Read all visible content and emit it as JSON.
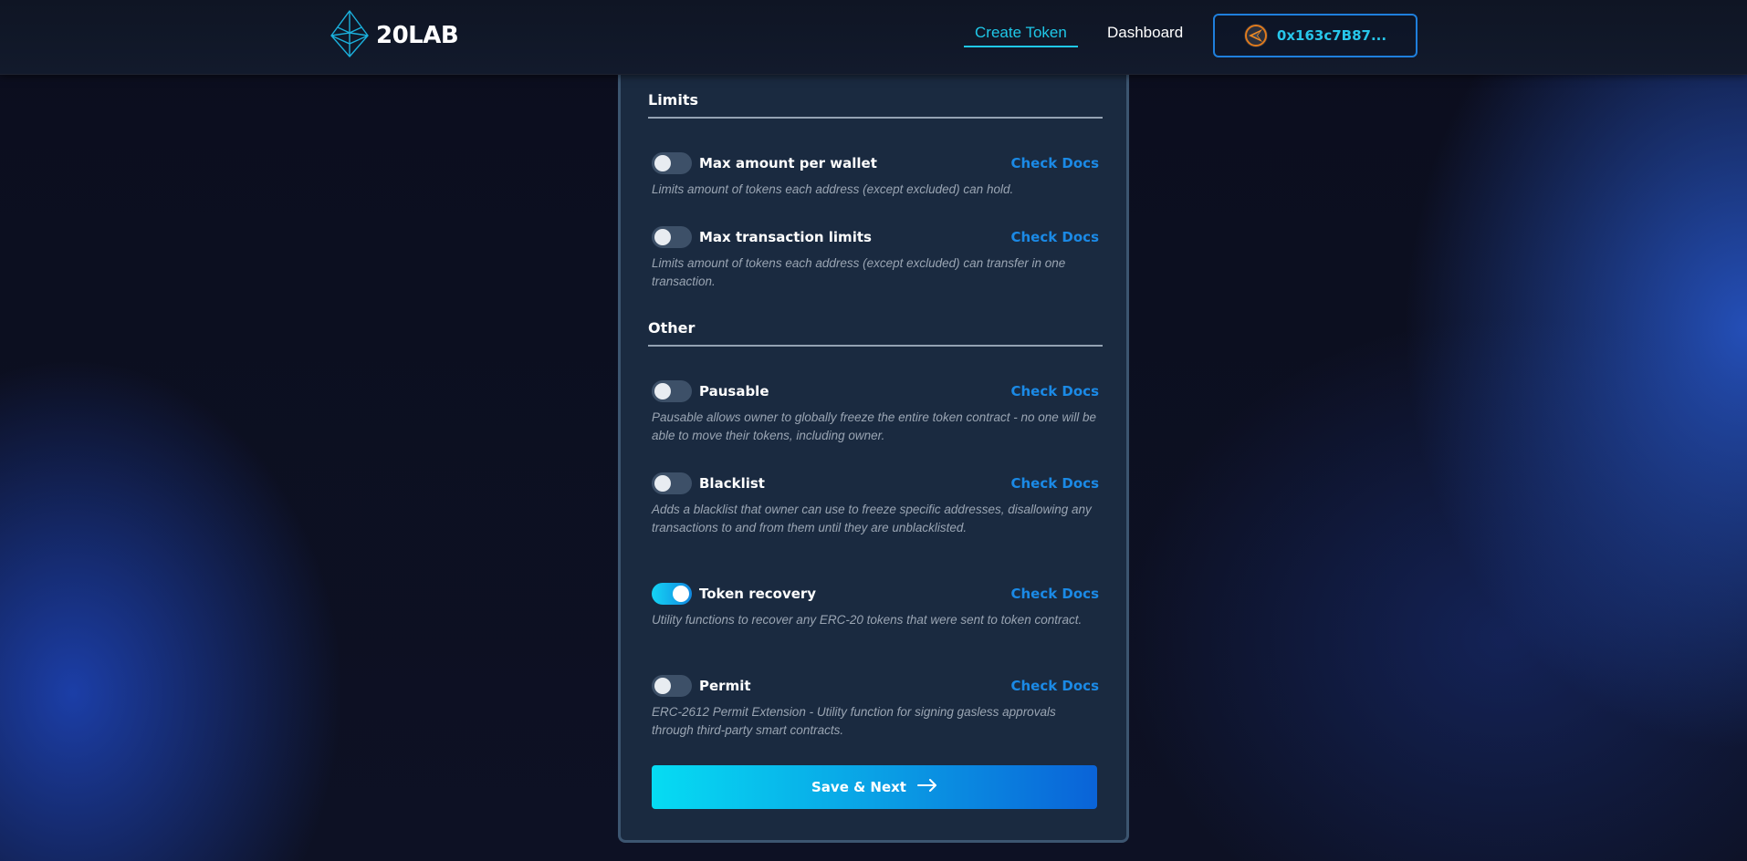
{
  "app": {
    "logo_text": "20LAB"
  },
  "nav": {
    "links": [
      {
        "label": "Create Token",
        "active": true
      },
      {
        "label": "Dashboard",
        "active": false
      }
    ],
    "wallet": {
      "address": "0x163c7B87..."
    }
  },
  "form": {
    "sections": [
      {
        "title": "Limits",
        "options": [
          {
            "label": "Max amount per wallet",
            "enabled": false,
            "docs_label": "Check Docs",
            "description": "Limits amount of tokens each address (except excluded) can hold."
          },
          {
            "label": "Max transaction limits",
            "enabled": false,
            "docs_label": "Check Docs",
            "description": "Limits amount of tokens each address (except excluded) can transfer in one transaction."
          }
        ]
      },
      {
        "title": "Other",
        "options": [
          {
            "label": "Pausable",
            "enabled": false,
            "docs_label": "Check Docs",
            "description": "Pausable allows owner to globally freeze the entire token contract - no one will be able to move their tokens, including owner."
          },
          {
            "label": "Blacklist",
            "enabled": false,
            "docs_label": "Check Docs",
            "description": "Adds a blacklist that owner can use to freeze specific addresses, disallowing any transactions to and from them until they are unblacklisted."
          },
          {
            "label": "Token recovery",
            "enabled": true,
            "docs_label": "Check Docs",
            "description": "Utility functions to recover any ERC-20 tokens that were sent to token contract."
          },
          {
            "label": "Permit",
            "enabled": false,
            "docs_label": "Check Docs",
            "description": "ERC-2612 Permit Extension - Utility function for signing gasless approvals through third-party smart contracts."
          }
        ]
      }
    ],
    "submit_label": "Save & Next"
  },
  "colors": {
    "accent": "#1fc8e8",
    "link": "#1b8ae6",
    "card": "#1a2a40",
    "toggle_on_start": "#14d4f4",
    "toggle_on_end": "#1288e0"
  }
}
